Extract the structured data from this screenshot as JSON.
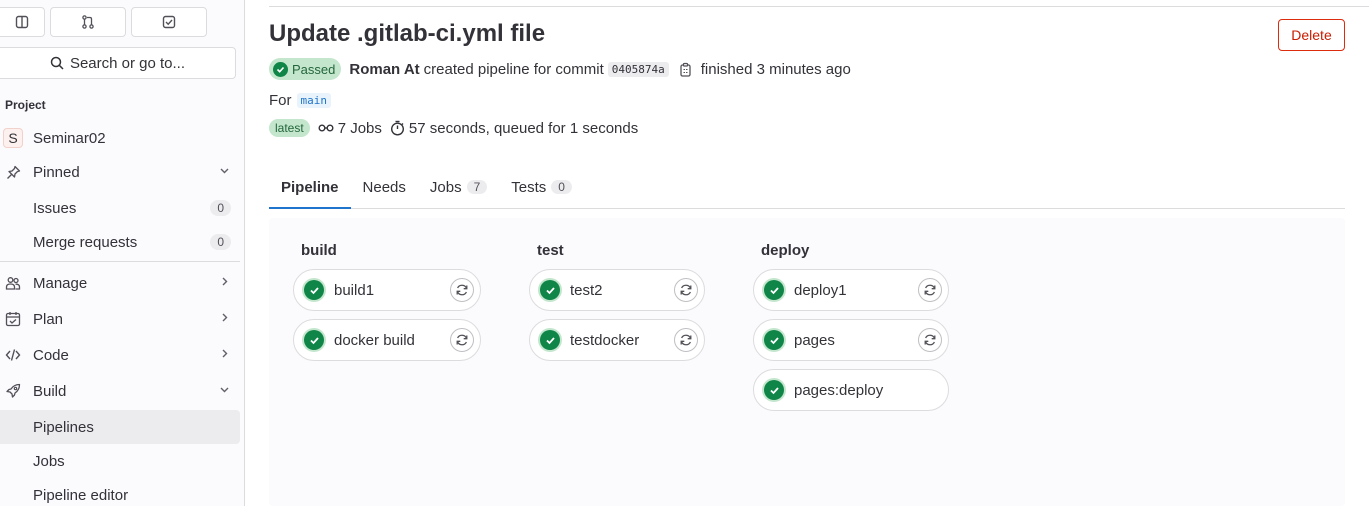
{
  "sidebar": {
    "search_label": "Search or go to...",
    "section_label": "Project",
    "project": {
      "avatar": "S",
      "name": "Seminar02"
    },
    "items": {
      "pinned": "Pinned",
      "issues": "Issues",
      "issues_count": "0",
      "merge_requests": "Merge requests",
      "merge_requests_count": "0",
      "manage": "Manage",
      "plan": "Plan",
      "code": "Code",
      "build": "Build",
      "pipelines": "Pipelines",
      "jobs": "Jobs",
      "pipeline_editor": "Pipeline editor"
    }
  },
  "pipeline": {
    "title": "Update .gitlab-ci.yml file",
    "delete_label": "Delete",
    "status": "Passed",
    "author": "Roman At",
    "created_text": "created pipeline for commit",
    "sha": "0405874a",
    "finished_text": "finished 3 minutes ago",
    "for_label": "For",
    "ref": "main",
    "latest_badge": "latest",
    "jobs_count_text": "7 Jobs",
    "duration_text": "57 seconds, queued for 1 seconds"
  },
  "tabs": [
    {
      "label": "Pipeline",
      "count": ""
    },
    {
      "label": "Needs",
      "count": ""
    },
    {
      "label": "Jobs",
      "count": "7"
    },
    {
      "label": "Tests",
      "count": "0"
    }
  ],
  "stages": [
    {
      "name": "build",
      "jobs": [
        "build1",
        "docker build"
      ]
    },
    {
      "name": "test",
      "jobs": [
        "test2",
        "testdocker"
      ]
    },
    {
      "name": "deploy",
      "jobs": [
        "deploy1",
        "pages",
        "pages:deploy"
      ]
    }
  ],
  "colors": {
    "success": "#108548",
    "accent": "#1f75cb",
    "danger": "#dd2b0e"
  }
}
